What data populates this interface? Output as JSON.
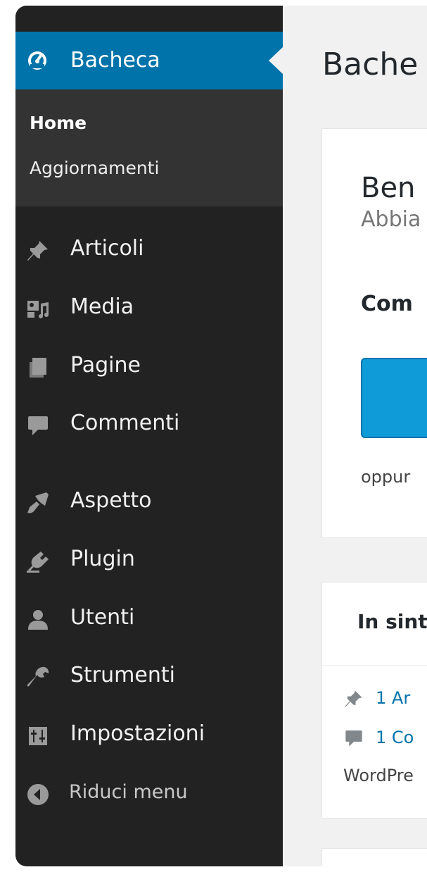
{
  "sidebar": {
    "active": {
      "label": "Bacheca",
      "icon": "dashboard-icon"
    },
    "submenu": [
      {
        "label": "Home",
        "current": true
      },
      {
        "label": "Aggiornamenti",
        "current": false
      }
    ],
    "items": [
      {
        "label": "Articoli",
        "icon": "pin-icon"
      },
      {
        "label": "Media",
        "icon": "media-icon"
      },
      {
        "label": "Pagine",
        "icon": "pages-icon"
      },
      {
        "label": "Commenti",
        "icon": "comment-icon"
      },
      {
        "label": "Aspetto",
        "icon": "brush-icon"
      },
      {
        "label": "Plugin",
        "icon": "plugin-icon"
      },
      {
        "label": "Utenti",
        "icon": "user-icon"
      },
      {
        "label": "Strumenti",
        "icon": "wrench-icon"
      },
      {
        "label": "Impostazioni",
        "icon": "settings-icon"
      }
    ],
    "collapse": {
      "label": "Riduci menu",
      "icon": "collapse-arrow-icon"
    }
  },
  "main": {
    "title": "Bache",
    "welcome": {
      "heading": "Ben",
      "subheading": "Abbia",
      "section_title": "Com",
      "or_text": "oppur"
    },
    "glance": {
      "title": "In sinte",
      "rows": [
        {
          "text": "1 Ar",
          "icon": "pin-icon"
        },
        {
          "text": "1 Co",
          "icon": "comment-icon"
        }
      ],
      "footer": "WordPre"
    }
  },
  "colors": {
    "sidebar_bg": "#222222",
    "submenu_bg": "#333333",
    "accent": "#0073aa",
    "button": "#0f9bd8",
    "content_bg": "#f1f1f1"
  }
}
